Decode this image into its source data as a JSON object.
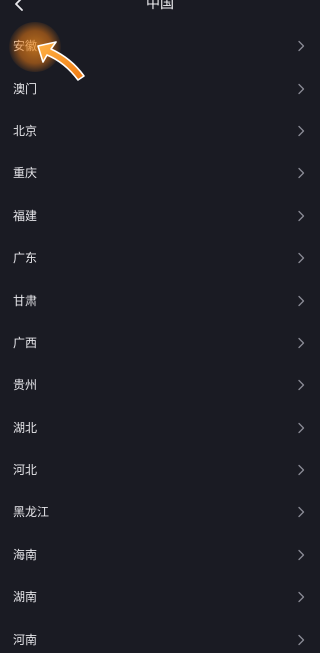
{
  "header": {
    "title": "中国"
  },
  "icons": {
    "back": "chevron-left-icon",
    "row": "chevron-right-icon",
    "pointer": "arrow-pointer-icon"
  },
  "colors": {
    "background": "#1a1b23",
    "text": "#e6e6ea",
    "chevron": "#8a8b95",
    "highlight": "#f08c1e"
  },
  "regions": [
    {
      "label": "安徽"
    },
    {
      "label": "澳门"
    },
    {
      "label": "北京"
    },
    {
      "label": "重庆"
    },
    {
      "label": "福建"
    },
    {
      "label": "广东"
    },
    {
      "label": "甘肃"
    },
    {
      "label": "广西"
    },
    {
      "label": "贵州"
    },
    {
      "label": "湖北"
    },
    {
      "label": "河北"
    },
    {
      "label": "黑龙江"
    },
    {
      "label": "海南"
    },
    {
      "label": "湖南"
    },
    {
      "label": "河南"
    }
  ]
}
